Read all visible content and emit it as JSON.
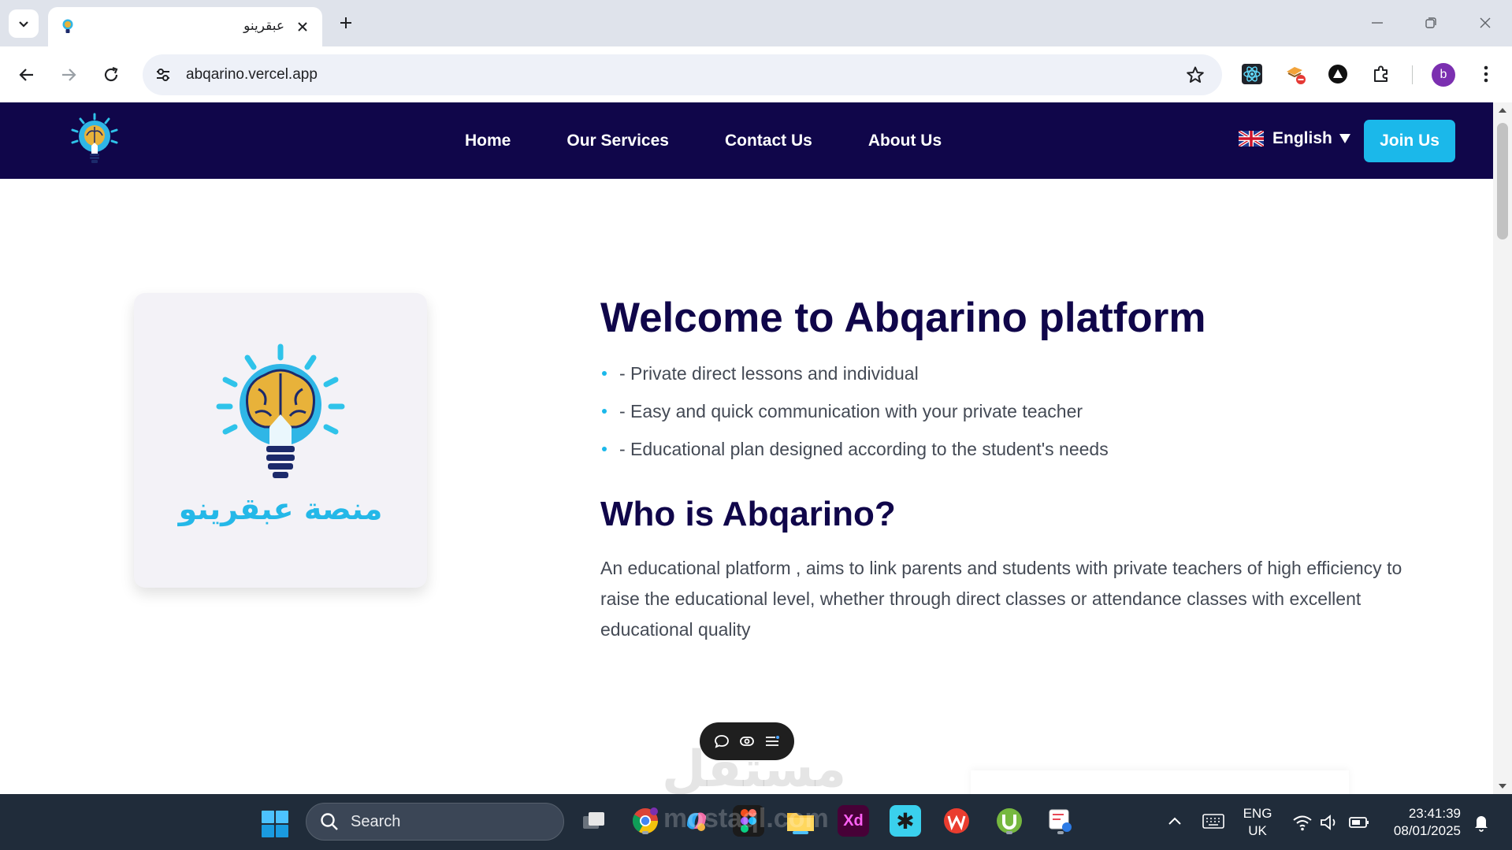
{
  "browser": {
    "tab_title": "عبقرينو",
    "url": "abqarino.vercel.app",
    "profile_initial": "b"
  },
  "site": {
    "nav": [
      "Home",
      "Our Services",
      "Contact Us",
      "About Us"
    ],
    "language": "English",
    "join_label": "Join Us",
    "brand_ar": "منصة عبقرينو",
    "welcome_title": "Welcome to Abqarino platform",
    "bullets": [
      "- Private direct lessons and individual",
      "- Easy and quick communication with your private teacher",
      "- Educational plan designed according to the student's needs"
    ],
    "who_title": "Who is Abqarino?",
    "who_desc": "An educational platform , aims to link parents and students with private teachers of high efficiency to raise the educational level, whether through direct classes or attendance classes with excellent educational quality",
    "watermark": "مستقل"
  },
  "taskbar": {
    "search_label": "Search",
    "lang_line1": "ENG",
    "lang_line2": "UK",
    "time": "23:41:39",
    "date": "08/01/2025",
    "watermark_url": "mostaql.com"
  },
  "colors": {
    "header_bg": "#10064a",
    "accent": "#1bb8ea",
    "title": "#10064a",
    "body_text": "#444a55"
  }
}
